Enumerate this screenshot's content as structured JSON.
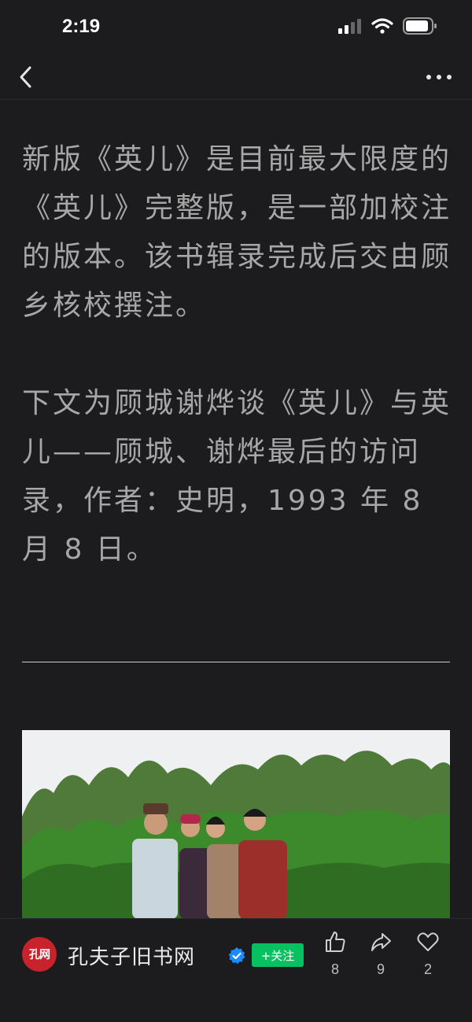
{
  "status_bar": {
    "time": "2:19"
  },
  "article": {
    "paragraphs": [
      "新版《英儿》是目前最大限度的《英儿》完整版，是一部加校注的版本。该书辑录完成后交由顾乡核校撰注。",
      "下文为顾城谢烨谈《英儿》与英儿——顾城、谢烨最后的访问录，作者：史明，1993 年 8 月 8 日。"
    ]
  },
  "author": {
    "avatar_text": "孔网",
    "name": "孔夫子旧书网",
    "follow_label": "+关注"
  },
  "actions": {
    "like_count": "8",
    "share_count": "9",
    "favorite_count": "2"
  },
  "colors": {
    "background": "#1c1c1e",
    "text": "#a7a7a7",
    "follow_green": "#07c160",
    "avatar_red": "#c8232c",
    "verified_blue": "#1a8cff"
  }
}
